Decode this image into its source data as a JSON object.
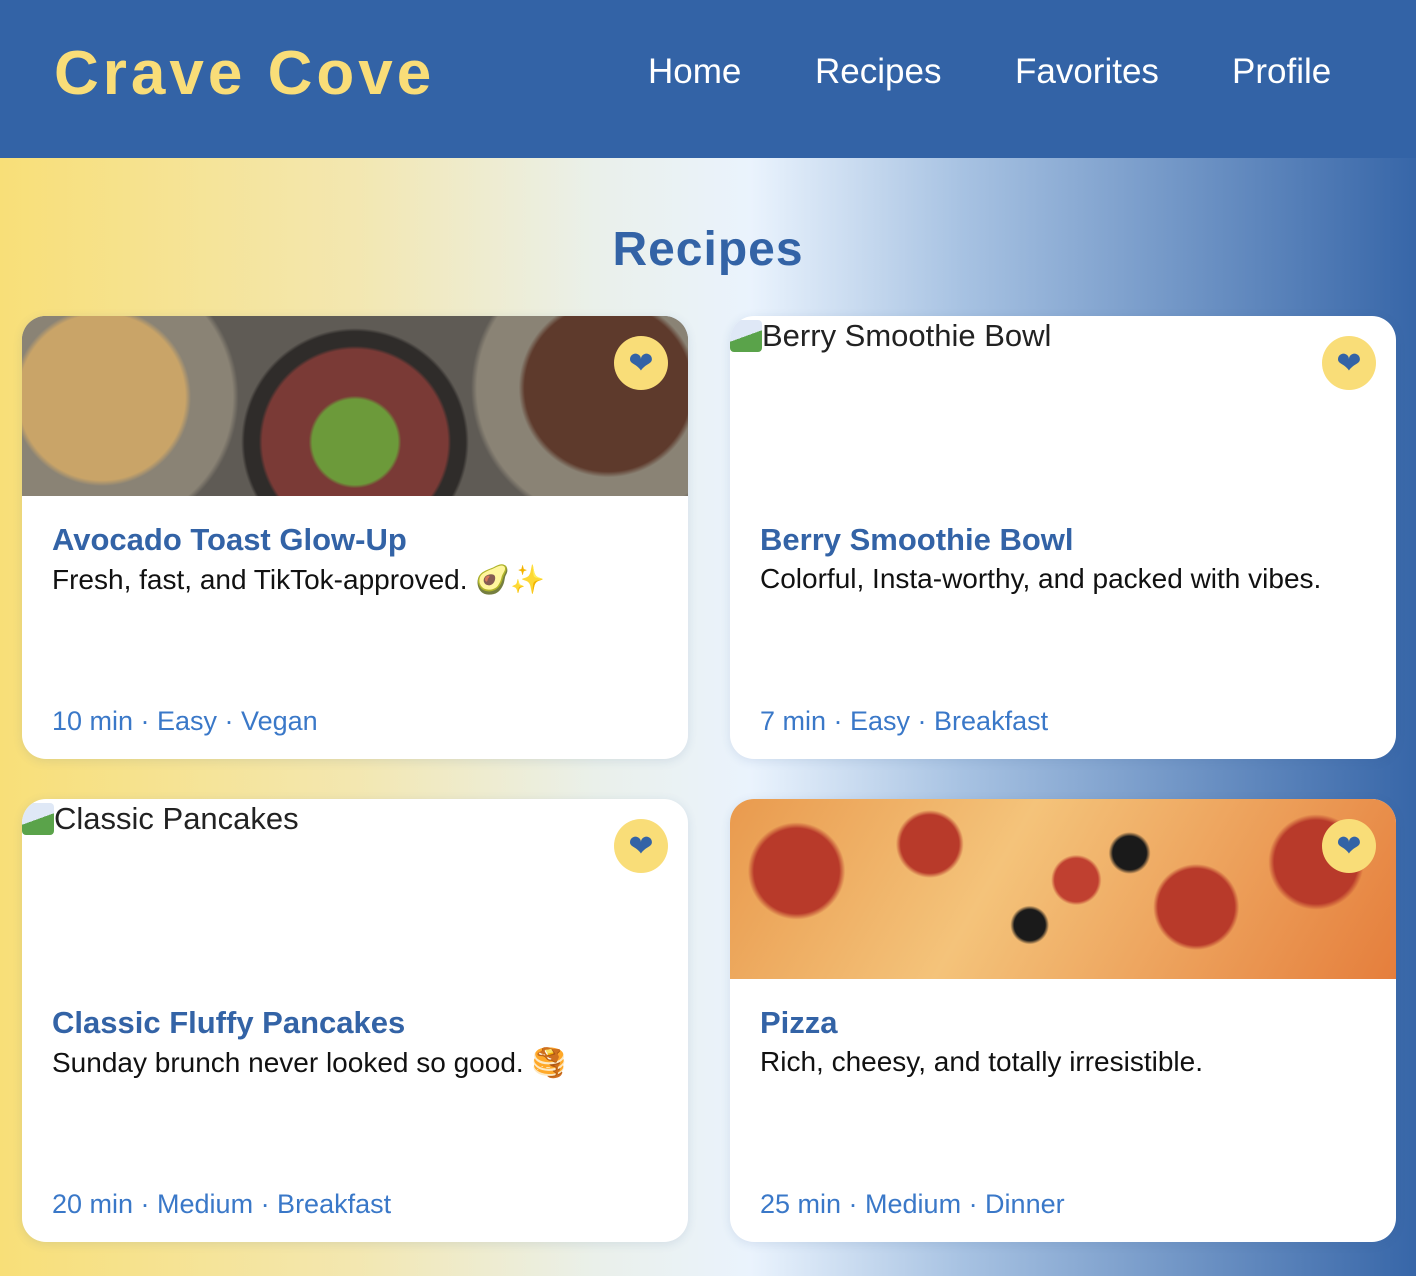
{
  "header": {
    "logo": "Crave Cove",
    "nav": [
      "Home",
      "Recipes",
      "Favorites",
      "Profile"
    ]
  },
  "page_title": "Recipes",
  "recipes": [
    {
      "title": "Avocado Toast Glow-Up",
      "description": "Fresh, fast, and TikTok-approved. 🥑✨",
      "meta": "10 min · Easy · Vegan",
      "image_alt": "",
      "image_loaded": true
    },
    {
      "title": "Berry Smoothie Bowl",
      "description": "Colorful, Insta-worthy, and packed with vibes.",
      "meta": "7 min · Easy · Breakfast",
      "image_alt": "Berry Smoothie Bowl",
      "image_loaded": false
    },
    {
      "title": "Classic Fluffy Pancakes",
      "description": "Sunday brunch never looked so good. 🥞",
      "meta": "20 min · Medium · Breakfast",
      "image_alt": "Classic Pancakes",
      "image_loaded": false
    },
    {
      "title": "Pizza",
      "description": "Rich, cheesy, and totally irresistible.",
      "meta": "25 min · Medium · Dinner",
      "image_alt": "",
      "image_loaded": true
    }
  ],
  "heart_icon": "❤",
  "colors": {
    "primary": "#3363a6",
    "accent": "#f9dd78",
    "meta": "#3a78c8"
  }
}
